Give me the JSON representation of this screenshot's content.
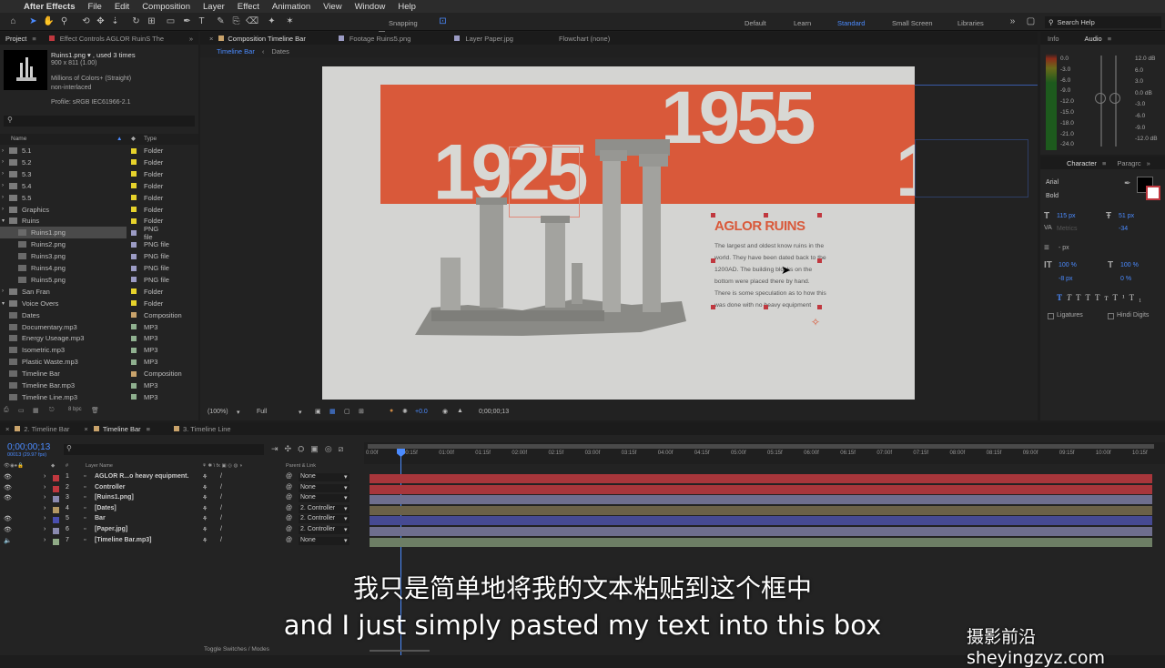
{
  "menu": {
    "apple": "",
    "app": "After Effects",
    "items": [
      "File",
      "Edit",
      "Composition",
      "Layer",
      "Effect",
      "Animation",
      "View",
      "Window",
      "Help"
    ]
  },
  "toolbar": {
    "snapping": "Snapping",
    "workspaces": [
      "Default",
      "Learn",
      "Standard",
      "Small Screen",
      "Libraries"
    ],
    "search": "Search Help"
  },
  "project": {
    "tabs": [
      "Project",
      "Effect Controls AGLOR RuinS The"
    ],
    "asset_name": "Ruins1.png ▾ , used 3 times",
    "asset_dims": "900 x 811 (1.00)",
    "asset_colors": "Millions of Colors+ (Straight)",
    "asset_interlace": "non-interlaced",
    "asset_profile": "Profile: sRGB IEC61966-2.1",
    "col_name": "Name",
    "col_type": "Type",
    "items": [
      {
        "name": "5.1",
        "type": "Folder",
        "color": "#e6d22b"
      },
      {
        "name": "5.2",
        "type": "Folder",
        "color": "#e6d22b"
      },
      {
        "name": "5.3",
        "type": "Folder",
        "color": "#e6d22b"
      },
      {
        "name": "5.4",
        "type": "Folder",
        "color": "#e6d22b"
      },
      {
        "name": "5.5",
        "type": "Folder",
        "color": "#e6d22b"
      },
      {
        "name": "Graphics",
        "type": "Folder",
        "color": "#e6d22b"
      },
      {
        "name": "Ruins",
        "type": "Folder",
        "color": "#e6d22b"
      },
      {
        "name": "Ruins1.png",
        "type": "PNG file",
        "color": "#9b9bc4"
      },
      {
        "name": "Ruins2.png",
        "type": "PNG file",
        "color": "#9b9bc4"
      },
      {
        "name": "Ruins3.png",
        "type": "PNG file",
        "color": "#9b9bc4"
      },
      {
        "name": "Ruins4.png",
        "type": "PNG file",
        "color": "#9b9bc4"
      },
      {
        "name": "Ruins5.png",
        "type": "PNG file",
        "color": "#9b9bc4"
      },
      {
        "name": "San Fran",
        "type": "Folder",
        "color": "#e6d22b"
      },
      {
        "name": "Voice Overs",
        "type": "Folder",
        "color": "#e6d22b"
      },
      {
        "name": "Dates",
        "type": "Composition",
        "color": "#c9a36b"
      },
      {
        "name": "Documentary.mp3",
        "type": "MP3",
        "color": "#8fb08f"
      },
      {
        "name": "Energy Useage.mp3",
        "type": "MP3",
        "color": "#8fb08f"
      },
      {
        "name": "Isometric.mp3",
        "type": "MP3",
        "color": "#8fb08f"
      },
      {
        "name": "Plastic Waste.mp3",
        "type": "MP3",
        "color": "#8fb08f"
      },
      {
        "name": "Timeline Bar",
        "type": "Composition",
        "color": "#c9a36b"
      },
      {
        "name": "Timeline Bar.mp3",
        "type": "MP3",
        "color": "#8fb08f"
      },
      {
        "name": "Timeline Line.mp3",
        "type": "MP3",
        "color": "#8fb08f"
      }
    ],
    "bpc": "8 bpc"
  },
  "viewer": {
    "tabs": [
      "Composition Timeline Bar",
      "Footage Ruins5.png",
      "Layer Paper.jpg",
      "Flowchart (none)"
    ],
    "crumbs": [
      "Timeline Bar",
      "Dates"
    ],
    "year1": "1925",
    "year2": "1955",
    "year3": "1",
    "heading": "AGLOR RUINS",
    "body": [
      "The largest and oldest know ruins in the",
      "world. They have been dated back to the",
      "1200AD. The building blocks on the",
      "bottom were placed there by hand.",
      "There is some speculation as to how this",
      "was done with no heavy equipment"
    ],
    "zoom": "(100%)",
    "quality": "Full",
    "exposure": "+0.0",
    "timecode": "0;00;00;13"
  },
  "info": {
    "tabs": [
      "Info",
      "Audio"
    ],
    "db_left": [
      "0.0",
      "-3.0",
      "-6.0",
      "-9.0",
      "-12.0",
      "-15.0",
      "-18.0",
      "-21.0",
      "-24.0"
    ],
    "db_right": [
      "12.0 dB",
      "6.0",
      "3.0",
      "0.0 dB",
      "-3.0",
      "-6.0",
      "-9.0",
      "-12.0 dB"
    ]
  },
  "character": {
    "tabs": [
      "Character",
      "Paragrc"
    ],
    "font": "Arial",
    "style": "Bold",
    "size": "115 px",
    "leading": "51 px",
    "kerning": "Metrics",
    "tracking": "-34",
    "stroke": "- px",
    "vscale": "100 %",
    "hscale": "100 %",
    "baseline": "-8 px",
    "tsume": "0 %",
    "ligatures": "Ligatures",
    "hindi": "Hindi Digits"
  },
  "timeline": {
    "tabs": [
      "2. Timeline Bar",
      "Timeline Bar",
      "3. Timeline Line"
    ],
    "time": "0;00;00;13",
    "fps": "00013 (29.97 fps)",
    "col_layer": "Layer Name",
    "col_parent": "Parent & Link",
    "layers": [
      {
        "num": "1",
        "name": "AGLOR R...o heavy equipment.",
        "parent": "None",
        "color": "#c0383f",
        "bar": "#a8363b"
      },
      {
        "num": "2",
        "name": "Controller",
        "parent": "None",
        "color": "#c0383f",
        "bar": "#a8363b"
      },
      {
        "num": "3",
        "name": "[Ruins1.png]",
        "parent": "None",
        "color": "#8a8ab0",
        "bar": "#6e6e8e"
      },
      {
        "num": "4",
        "name": "[Dates]",
        "parent": "2. Controller",
        "color": "#b39863",
        "bar": "#6b6148"
      },
      {
        "num": "5",
        "name": "Bar",
        "parent": "2. Controller",
        "color": "#4a4fb0",
        "bar": "#464a93"
      },
      {
        "num": "6",
        "name": "[Paper.jpg]",
        "parent": "2. Controller",
        "color": "#8a8ab0",
        "bar": "#6e6e8e"
      },
      {
        "num": "7",
        "name": "[Timeline Bar.mp3]",
        "parent": "None",
        "color": "#8faa86",
        "bar": "#6d7e65"
      }
    ],
    "ruler": [
      "0:00f",
      "00:15f",
      "01:00f",
      "01:15f",
      "02:00f",
      "02:15f",
      "03:00f",
      "03:15f",
      "04:00f",
      "04:15f",
      "05:00f",
      "05:15f",
      "06:00f",
      "06:15f",
      "07:00f",
      "07:15f",
      "08:00f",
      "08:15f",
      "09:00f",
      "09:15f",
      "10:00f",
      "10:15f"
    ],
    "toggle": "Toggle Switches / Modes"
  },
  "subtitles": {
    "zh": "我只是简单地将我的文本粘贴到这个框中",
    "en": "and I just simply pasted my text into this box",
    "watermark": "摄影前沿 sheyingzyz.com"
  }
}
